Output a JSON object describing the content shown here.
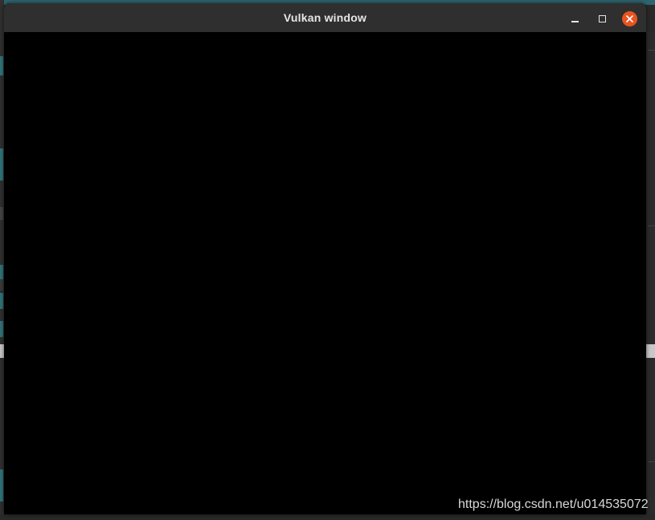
{
  "window": {
    "title": "Vulkan window",
    "controls": {
      "minimize_icon": "minimize-icon",
      "maximize_icon": "maximize-icon",
      "close_icon": "close-icon"
    },
    "colors": {
      "titlebar": "#2f2f2f",
      "client": "#000000",
      "close_button": "#e95420"
    }
  },
  "watermark": {
    "text": "https://blog.csdn.net/u014535072"
  }
}
